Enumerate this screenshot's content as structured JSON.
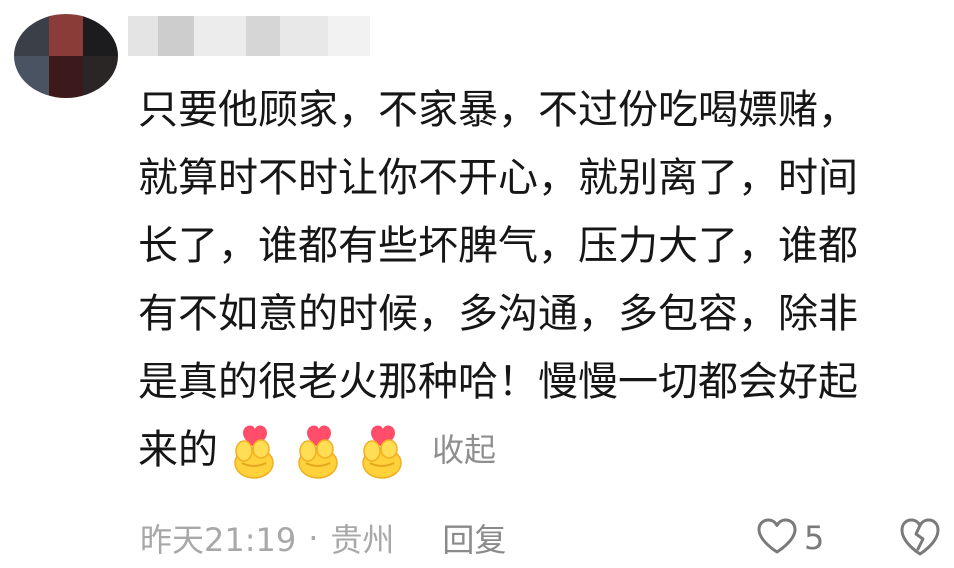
{
  "comment": {
    "lines": [
      "只要他顾家，不家暴，不过份吃喝嫖赌，",
      "就算时不时让你不开心，就别离了，时间",
      "长了，谁都有些坏脾气，压力大了，谁都",
      "有不如意的时候，多沟通，多包容，除非",
      "是真的很老火那种哈！慢慢一切都会好起",
      "来的"
    ],
    "emojis": [
      "finger-heart-emoji",
      "finger-heart-emoji",
      "finger-heart-emoji"
    ],
    "collapse_label": "收起"
  },
  "meta": {
    "time": "昨天21:19",
    "separator": "·",
    "location": "贵州",
    "reply_label": "回复"
  },
  "actions": {
    "like_icon": "heart-outline-icon",
    "like_count": "5",
    "dislike_icon": "broken-heart-icon"
  },
  "colors": {
    "text": "#161616",
    "muted": "#a8a8a8",
    "emoji_yellow": "#ffd23c",
    "emoji_heart": "#ff4d6a"
  }
}
